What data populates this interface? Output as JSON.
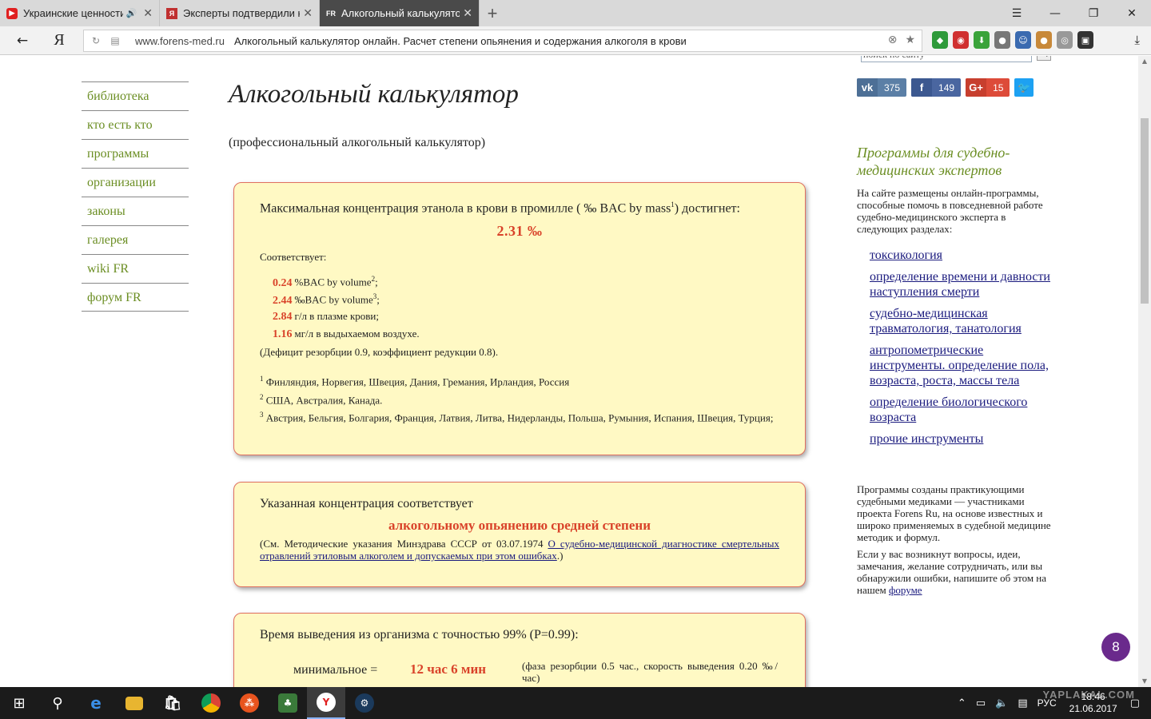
{
  "browser": {
    "tabs": [
      {
        "title": "Украинские ценности",
        "favicon_color": "#e02020",
        "has_sound": true
      },
      {
        "title": "Эксперты подтвердили на",
        "favicon_color": "#c03030",
        "has_sound": false
      },
      {
        "title": "Алкогольный калькулятор",
        "favicon_text": "FR",
        "favicon_color": "#4a4a4a",
        "has_sound": false
      }
    ],
    "window_controls": [
      "☰",
      "—",
      "❐",
      "✕"
    ],
    "address": {
      "domain": "www.forens-med.ru",
      "page_title": "Алкогольный калькулятор онлайн. Расчет степени опьянения и содержания алкоголя в крови"
    }
  },
  "nav": {
    "items": [
      "библиотека",
      "кто есть кто",
      "программы",
      "организации",
      "законы",
      "галерея",
      "wiki FR",
      "форум FR"
    ]
  },
  "main": {
    "title": "Алкогольный калькулятор",
    "subtitle": "(профессиональный алкогольный калькулятор)",
    "box1": {
      "head_a": "Максимальная концентрация этанола в крови в промилле ( ‰ BAC by mass",
      "head_sup": "1",
      "head_b": ") достигнет:",
      "result": "2.31 ‰",
      "corresponds": "Соответствует:",
      "values": [
        {
          "num": "0.24",
          "text": "%BAC by volume",
          "sup": "2",
          "tail": ";"
        },
        {
          "num": "2.44",
          "text": "‰BAC by volume",
          "sup": "3",
          "tail": ";"
        },
        {
          "num": "2.84",
          "text": "г/л в плазме крови;",
          "sup": "",
          "tail": ""
        },
        {
          "num": "1.16",
          "text": "мг/л в выдыхаемом воздухе.",
          "sup": "",
          "tail": ""
        }
      ],
      "deficit": "(Дефицит резорбции 0.9, коэффициент редукции 0.8).",
      "footnotes": [
        {
          "sup": "1",
          "text": " Финляндия, Норвегия, Швеция, Дания, Гремания, Ирландия, Россия"
        },
        {
          "sup": "2",
          "text": " США, Австралия, Канада."
        },
        {
          "sup": "3",
          "text": " Австрия, Бельгия, Болгария, Франция, Латвия, Литва, Нидерланды, Польша, Румыния, Испания, Швеция, Турция;"
        }
      ]
    },
    "box2": {
      "head": "Указанная концентрация соответствует",
      "state": "алкогольному опьянению средней степени",
      "ref_a": "(См. Методические указания Минздрава СССР от 03.07.1974 ",
      "ref_link": "О судебно-медицинской диагностике смертельных отравлений этиловым алкоголем и допускаемых при этом ошибках",
      "ref_b": ".)"
    },
    "box3": {
      "head": "Время выведения из организма с точностью 99% (P=0.99):",
      "min_label": "минимальное =",
      "min_value": "12 час 6 мин",
      "min_note": "(фаза резорбции 0.5 час., скорость выведения 0.20 ‰/час)"
    }
  },
  "sidebar": {
    "search_placeholder": "поиск по сайту",
    "share": [
      {
        "network": "vk",
        "icon": "vk",
        "count": "375"
      },
      {
        "network": "facebook",
        "icon": "f",
        "count": "149"
      },
      {
        "network": "google-plus",
        "icon": "G+",
        "count": "15"
      },
      {
        "network": "twitter",
        "icon": "🐦",
        "count": ""
      }
    ],
    "title": "Программы для судебно-медицинских экспертов",
    "intro": "На сайте размещены онлайн-программы, способные помочь в повседневной работе судебно-медицинского эксперта в следующих разделах:",
    "links": [
      "токсикология",
      "определение времени и давности наступления смерти",
      "судебно-медицинская травматология, танатология",
      "антропометрические инструменты. определение пола, возраста, роста, массы тела",
      "определение биологического возраста",
      "прочие инструменты"
    ],
    "text1": "Программы созданы практикующими судебными медиками — участниками проекта Forens Ru, на основе известных и широко применяемых в судебной медицине методик и формул.",
    "text2_a": "Если у вас возникнут вопросы, идеи, замечания, желание сотрудничать, или вы обнаружили ошибки, напишите об этом на нашем ",
    "text2_link": "форуме",
    "badge": "8"
  },
  "taskbar": {
    "lang": "РУС",
    "time": "18:46",
    "date": "21.06.2017",
    "watermark": "YAPLAKAL.COM"
  },
  "colors": {
    "accent_green": "#6b8e23",
    "result_red": "#d9432a",
    "box_bg": "#fff9c4",
    "box_border": "#e07060",
    "link_blue": "#1a1a7e"
  }
}
